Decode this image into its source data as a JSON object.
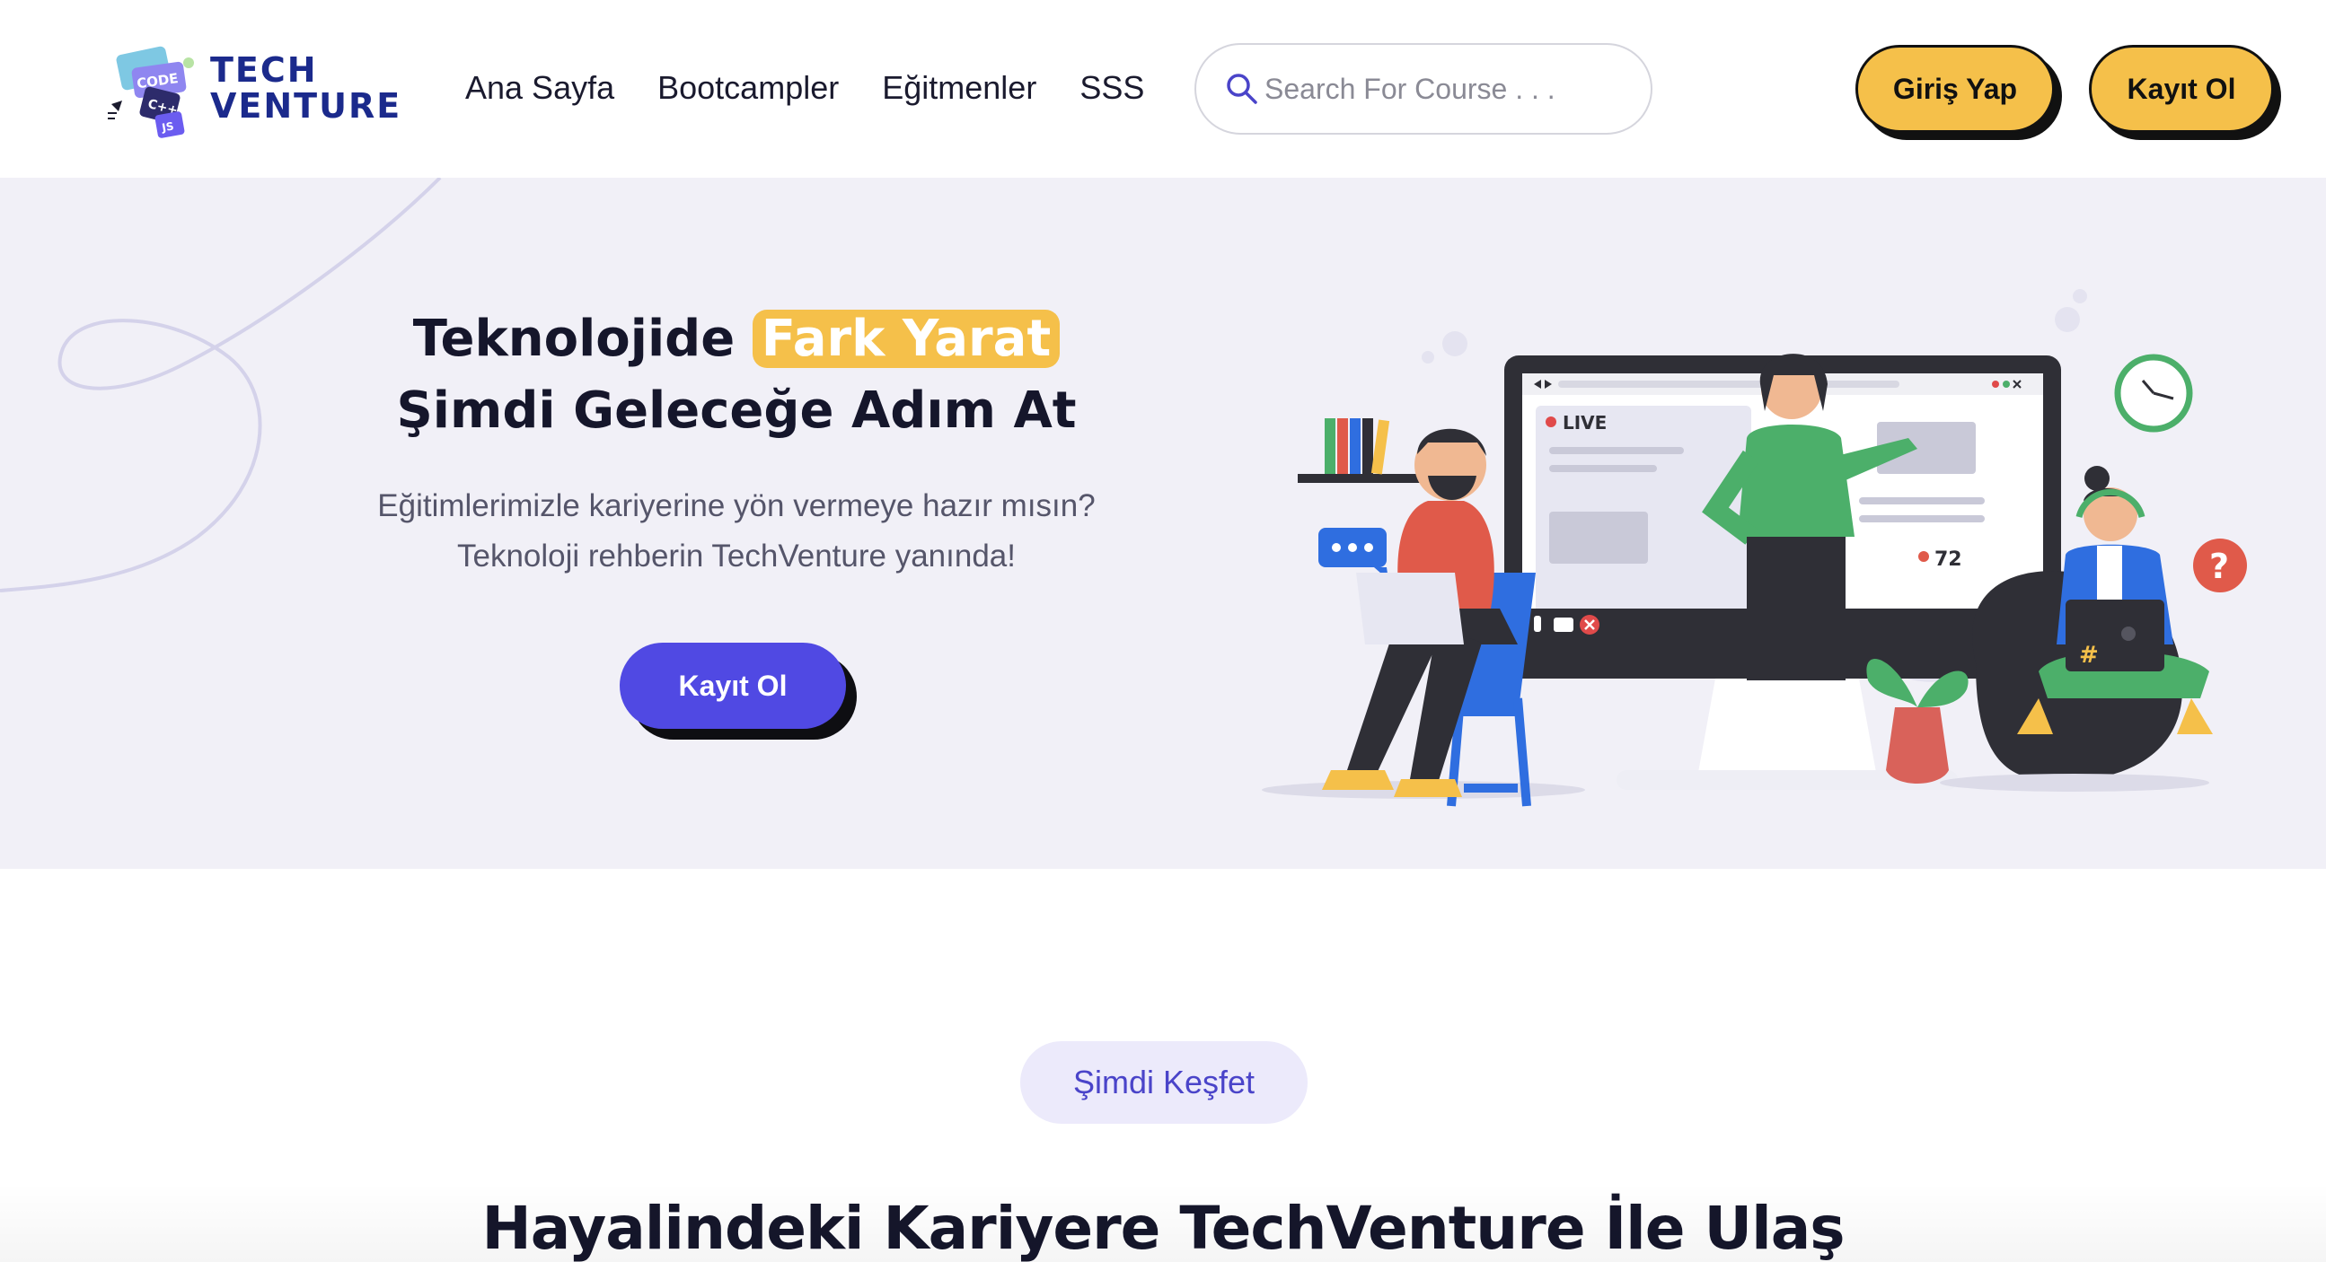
{
  "brand": {
    "line1": "TECH",
    "line2": "VENTURE",
    "mark_labels": [
      "CODE",
      "C++",
      "JS"
    ]
  },
  "nav": {
    "items": [
      {
        "label": "Ana Sayfa"
      },
      {
        "label": "Bootcampler"
      },
      {
        "label": "Eğitmenler"
      },
      {
        "label": "SSS"
      }
    ]
  },
  "search": {
    "placeholder": "Search For Course . . ."
  },
  "header": {
    "login_label": "Giriş Yap",
    "register_label": "Kayıt Ol"
  },
  "hero": {
    "title_part1": "Teknolojide",
    "title_highlight": "Fark Yarat",
    "title_line2": "Şimdi Geleceğe Adım At",
    "subtitle_line1": "Eğitimlerimizle kariyerine yön vermeye hazır mısın?",
    "subtitle_line2": "Teknoloji rehberin TechVenture yanında!",
    "cta_label": "Kayıt Ol"
  },
  "illustration": {
    "live_label": "LIVE",
    "viewer_count": "72",
    "help_mark": "?",
    "hash_mark": "#"
  },
  "explore": {
    "label": "Şimdi Keşfet"
  },
  "section": {
    "title": "Hayalindeki Kariyere TechVenture İle Ulaş"
  },
  "colors": {
    "accent_yellow": "#f5c04a",
    "primary_purple": "#5049e3",
    "brand_navy": "#1b2a8c",
    "hero_bg": "#f1f0f7",
    "pill_bg": "#eceafb"
  }
}
